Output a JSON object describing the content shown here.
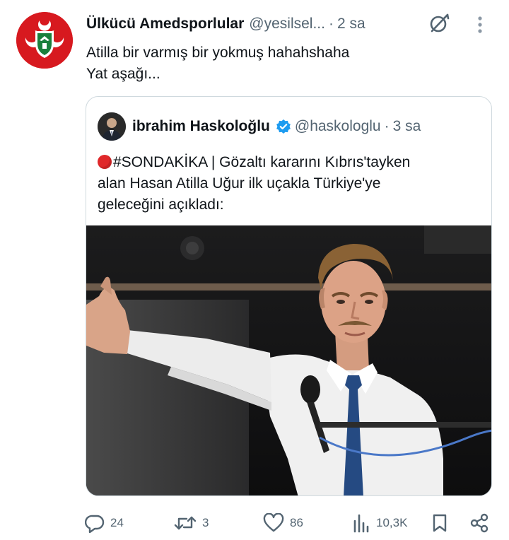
{
  "tweet": {
    "author_name": "Ülkücü Amedsporlular",
    "author_handle": "@yesilsel...",
    "separator": "·",
    "time": "2 sa",
    "text_line1": "Atilla bir varmış bir yokmuş hahahshaha",
    "text_line2": "Yat aşağı..."
  },
  "quoted": {
    "author_name": "ibrahim Haskoloğlu",
    "author_handle": "@haskologlu",
    "separator": "·",
    "time": "3 sa",
    "text_line1": "#SONDAKİKA | Gözaltı kararını Kıbrıs'tayken",
    "text_line2": "alan Hasan Atilla Uğur ilk uçakla Türkiye'ye",
    "text_line3": "geleceğini açıkladı:"
  },
  "actions": {
    "replies": "24",
    "reposts": "3",
    "likes": "86",
    "views": "10,3K"
  },
  "icons": {
    "avatar": "club-logo-icon",
    "grok": "grok-icon",
    "more": "more-vertical-icon",
    "verified": "verified-badge-icon",
    "breaking": "red-circle-emoji",
    "reply": "reply-icon",
    "repost": "repost-icon",
    "like": "heart-icon",
    "views": "views-icon",
    "bookmark": "bookmark-icon",
    "share": "share-icon"
  },
  "colors": {
    "text_primary": "#0f1419",
    "text_secondary": "#536471",
    "border": "#cfd9de",
    "verified_blue": "#1d9bf0",
    "brand_red": "#d7191f",
    "brand_green": "#1a7f3c"
  }
}
